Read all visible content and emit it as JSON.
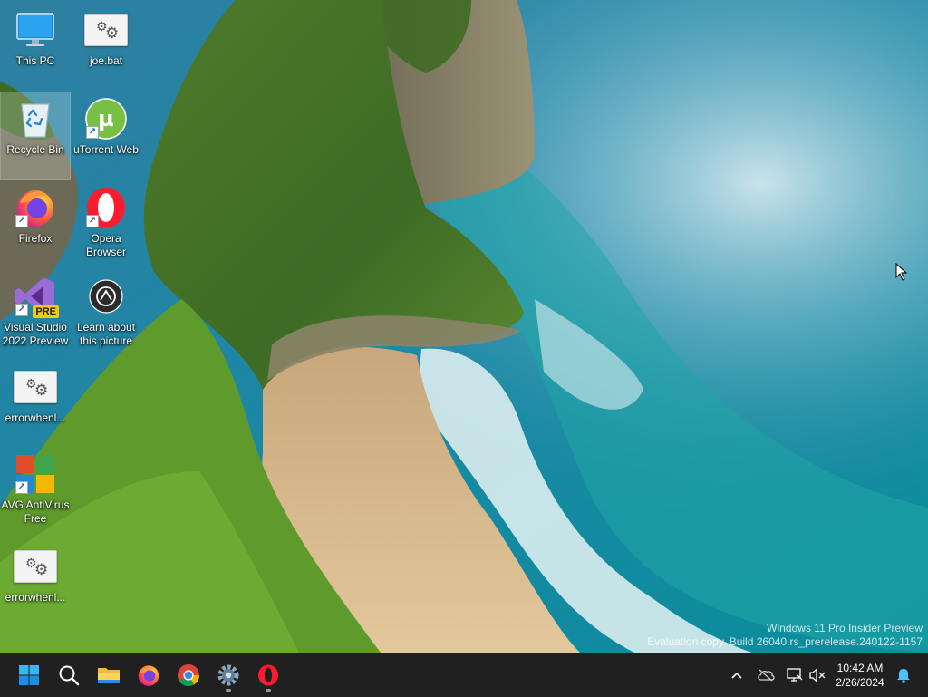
{
  "desktop": {
    "icons": [
      {
        "label": "This PC",
        "icon": "monitor-icon"
      },
      {
        "label": "joe.bat",
        "icon": "batch-file-icon"
      },
      {
        "label": "Recycle Bin",
        "icon": "recycle-bin-icon"
      },
      {
        "label": "uTorrent Web",
        "icon": "utorrent-icon"
      },
      {
        "label": "Firefox",
        "icon": "firefox-icon"
      },
      {
        "label": "Opera\nBrowser",
        "icon": "opera-icon"
      },
      {
        "label": "Visual Studio\n2022 Preview",
        "icon": "visual-studio-icon",
        "badge": "PRE"
      },
      {
        "label": "Learn about\nthis picture",
        "icon": "camera-icon"
      },
      {
        "label": "errorwhenl...",
        "icon": "batch-file-icon"
      },
      {
        "label": "AVG AntiVirus\nFree",
        "icon": "avg-icon"
      },
      {
        "label": "errorwhenl...",
        "icon": "batch-file-icon"
      }
    ]
  },
  "watermark": {
    "line1": "Windows 11 Pro Insider Preview",
    "line2": "Evaluation copy. Build 26040.rs_prerelease.240122-1157"
  },
  "taskbar": {
    "apps": [
      "start-icon",
      "search-icon",
      "file-explorer-icon",
      "firefox-icon",
      "chrome-icon",
      "settings-icon",
      "opera-icon"
    ],
    "tray_icons": [
      "chevron-up-icon",
      "onedrive-offline-icon",
      "network-icon",
      "volume-muted-icon"
    ],
    "time": "10:42 AM",
    "date": "2/26/2024",
    "notification_icon": "bell-icon"
  },
  "colors": {
    "taskbar_bg": "#202020",
    "accent": "#0078d4"
  }
}
